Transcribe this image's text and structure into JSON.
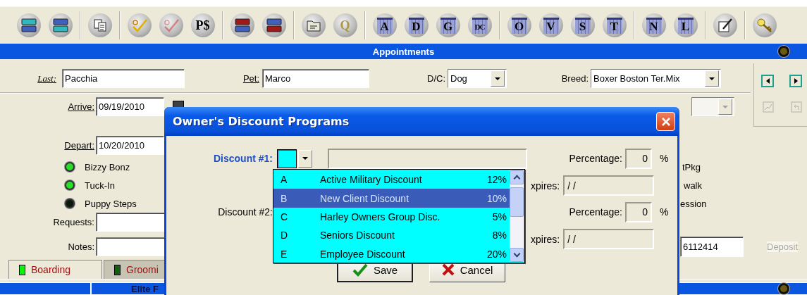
{
  "toolbar": [
    {
      "kind": "stack",
      "color": "#30b8c0",
      "flipped": false
    },
    {
      "kind": "stack",
      "color": "#30b8c0",
      "flipped": true
    },
    {
      "kind": "separator"
    },
    {
      "kind": "copy"
    },
    {
      "kind": "separator"
    },
    {
      "kind": "check",
      "disabled": false
    },
    {
      "kind": "check",
      "disabled": true
    },
    {
      "kind": "text",
      "label": "P$",
      "color": "#000000"
    },
    {
      "kind": "separator"
    },
    {
      "kind": "stack",
      "color": "#a01818",
      "flipped": false
    },
    {
      "kind": "stack",
      "color": "#a01818",
      "flipped": true
    },
    {
      "kind": "separator"
    },
    {
      "kind": "folder"
    },
    {
      "kind": "text",
      "label": "Q",
      "color": "#a89848"
    },
    {
      "kind": "separator"
    },
    {
      "kind": "letter",
      "label": "A"
    },
    {
      "kind": "letter",
      "label": "D"
    },
    {
      "kind": "letter",
      "label": "G"
    },
    {
      "kind": "letter",
      "label": "DC"
    },
    {
      "kind": "separator"
    },
    {
      "kind": "letter",
      "label": "O"
    },
    {
      "kind": "letter",
      "label": "V"
    },
    {
      "kind": "letter",
      "label": "S"
    },
    {
      "kind": "letter",
      "label": "T"
    },
    {
      "kind": "separator"
    },
    {
      "kind": "letter",
      "label": "N"
    },
    {
      "kind": "letter",
      "label": "L"
    },
    {
      "kind": "separator"
    },
    {
      "kind": "edit"
    },
    {
      "kind": "separator"
    },
    {
      "kind": "key"
    }
  ],
  "title_bar": {
    "title": "Appointments"
  },
  "form": {
    "last": {
      "label": "Last:",
      "value": "Pacchia"
    },
    "pet": {
      "label": "Pet:",
      "value": "Marco"
    },
    "dc": {
      "label": "D/C:",
      "value": "Dog"
    },
    "breed": {
      "label": "Breed:",
      "value": "Boxer Boston Ter.Mix"
    },
    "arrive": {
      "label": "Arrive:",
      "value": "09/19/2010"
    },
    "depart": {
      "label": "Depart:",
      "value": "10/20/2010"
    },
    "options": [
      {
        "label": "Bizzy Bonz",
        "on": true
      },
      {
        "label": "Tuck-In",
        "on": true
      },
      {
        "label": "Puppy Steps",
        "on": false
      }
    ],
    "side_texts": [
      "tPkg",
      "walk",
      "ession"
    ],
    "requests": {
      "label": "Requests:"
    },
    "notes": {
      "label": "Notes:"
    },
    "phone": "6112414",
    "deposit": {
      "label": "Deposit",
      "disabled": true
    }
  },
  "tabs": [
    {
      "label": "Boarding",
      "selected": true
    },
    {
      "label": "Groomi",
      "selected": false
    }
  ],
  "bottom_bar": {
    "text": "Elite F"
  },
  "dialog": {
    "title": "Owner's Discount Programs",
    "discounts": [
      {
        "label": "Discount #1:",
        "focused": true,
        "percentage_label": "Percentage:",
        "percentage": "0",
        "unit": "%",
        "expires_label": "xpires:",
        "expires": "/ /",
        "options": [
          {
            "code": "A",
            "name": "Active Military Discount",
            "percent": "12%",
            "selected": false
          },
          {
            "code": "B",
            "name": "New Client Discount",
            "percent": "10%",
            "selected": true
          },
          {
            "code": "C",
            "name": "Harley Owners Group Disc.",
            "percent": "5%",
            "selected": false
          },
          {
            "code": "D",
            "name": "Seniors Discount",
            "percent": "8%",
            "selected": false
          },
          {
            "code": "E",
            "name": "Employee Discount",
            "percent": "20%",
            "selected": false
          }
        ]
      },
      {
        "label": "Discount #2:",
        "focused": false,
        "percentage_label": "Percentage:",
        "percentage": "0",
        "unit": "%",
        "expires_label": "xpires:",
        "expires": "/ /"
      }
    ],
    "buttons": [
      {
        "kind": "save",
        "label": "Save"
      },
      {
        "kind": "cancel",
        "label": "Cancel"
      }
    ]
  }
}
